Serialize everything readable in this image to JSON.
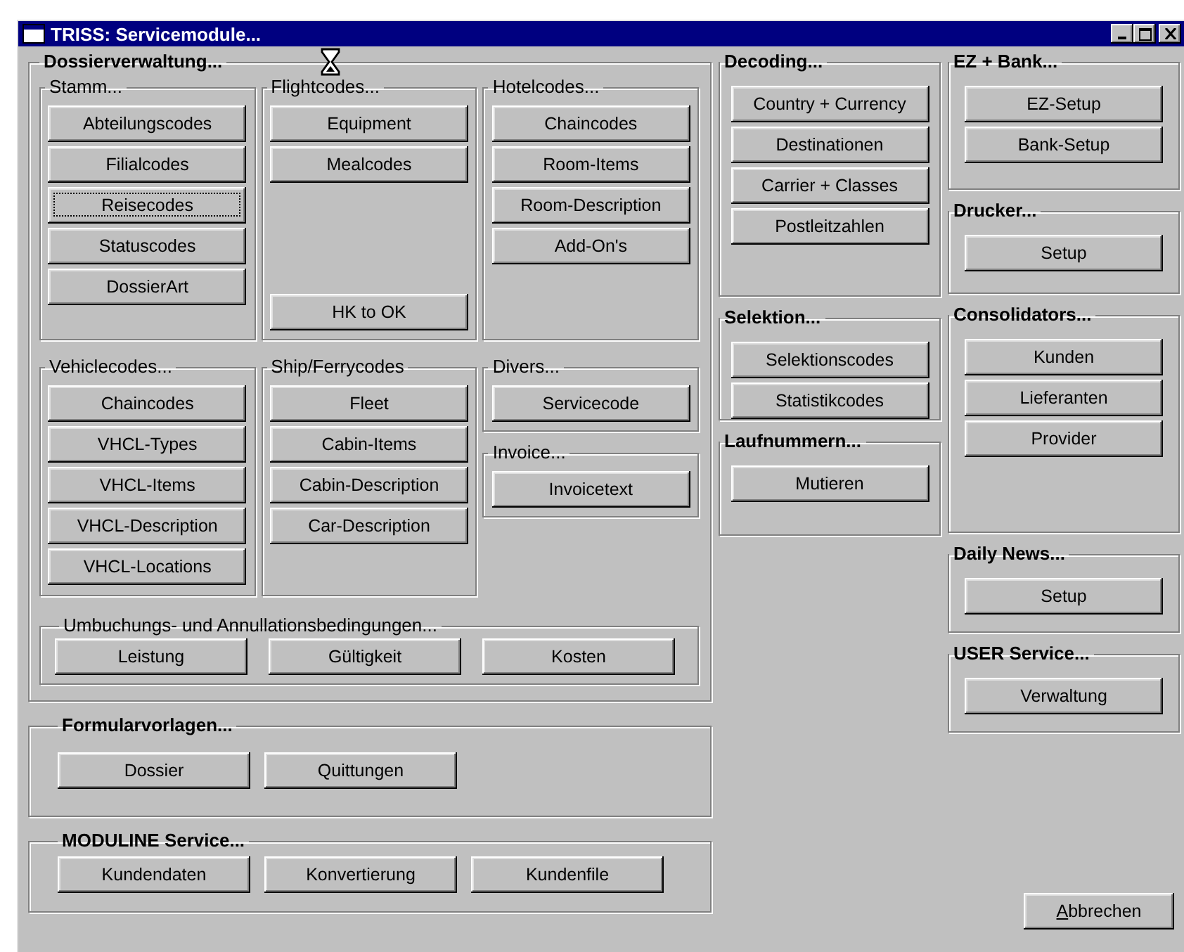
{
  "window": {
    "title": "TRISS: Servicemodule..."
  },
  "dossier": {
    "title": "Dossierverwaltung...",
    "rows": [
      [
        [
          {
            "title": "Stamm...",
            "buttons": [
              {
                "label": "Abteilungscodes",
                "focused": false
              },
              {
                "label": "Filialcodes",
                "focused": false
              },
              {
                "label": "Reisecodes",
                "focused": true
              },
              {
                "label": "Statuscodes",
                "focused": false
              },
              {
                "label": "DossierArt",
                "focused": false
              }
            ]
          }
        ],
        [
          {
            "title": "Flightcodes...",
            "buttons": [
              {
                "label": "Equipment",
                "focused": false
              },
              {
                "label": "Mealcodes",
                "focused": false
              },
              {
                "label": "HK to OK",
                "focused": false
              }
            ]
          }
        ],
        [
          {
            "title": "Hotelcodes...",
            "buttons": [
              {
                "label": "Chaincodes",
                "focused": false
              },
              {
                "label": "Room-Items",
                "focused": false
              },
              {
                "label": "Room-Description",
                "focused": false
              },
              {
                "label": "Add-On's",
                "focused": false
              }
            ]
          }
        ]
      ],
      [
        [
          {
            "title": "Vehiclecodes...",
            "buttons": [
              {
                "label": "Chaincodes",
                "focused": false
              },
              {
                "label": "VHCL-Types",
                "focused": false
              },
              {
                "label": "VHCL-Items",
                "focused": false
              },
              {
                "label": "VHCL-Description",
                "focused": false
              },
              {
                "label": "VHCL-Locations",
                "focused": false
              }
            ]
          }
        ],
        [
          {
            "title": "Ship/Ferrycodes",
            "buttons": [
              {
                "label": "Fleet",
                "focused": false
              },
              {
                "label": "Cabin-Items",
                "focused": false
              },
              {
                "label": "Cabin-Description",
                "focused": false
              },
              {
                "label": "Car-Description",
                "focused": false
              }
            ]
          }
        ],
        [
          {
            "title": "Divers...",
            "buttons": [
              {
                "label": "Servicecode",
                "focused": false
              }
            ]
          },
          {
            "title": "Invoice...",
            "buttons": [
              {
                "label": "Invoicetext",
                "focused": false
              }
            ]
          }
        ]
      ]
    ],
    "conditions": {
      "title": "Umbuchungs- und Annullationsbedingungen...",
      "buttons": [
        {
          "label": "Leistung",
          "focused": false
        },
        {
          "label": "Gültigkeit",
          "focused": false
        },
        {
          "label": "Kosten",
          "focused": false
        }
      ]
    }
  },
  "lower_groups": [
    {
      "title": "Formularvorlagen...",
      "buttons": [
        {
          "label": "Dossier",
          "focused": false
        },
        {
          "label": "Quittungen",
          "focused": false
        }
      ]
    },
    {
      "title": "MODULINE Service...",
      "buttons": [
        {
          "label": "Kundendaten",
          "focused": false
        },
        {
          "label": "Konvertierung",
          "focused": false
        },
        {
          "label": "Kundenfile",
          "focused": false
        }
      ]
    }
  ],
  "middle_column": [
    {
      "title": "Decoding...",
      "buttons": [
        {
          "label": "Country + Currency",
          "focused": false
        },
        {
          "label": "Destinationen",
          "focused": false
        },
        {
          "label": "Carrier + Classes",
          "focused": false
        },
        {
          "label": "Postleitzahlen",
          "focused": false
        }
      ]
    },
    {
      "title": "Selektion...",
      "buttons": [
        {
          "label": "Selektionscodes",
          "focused": false
        },
        {
          "label": "Statistikcodes",
          "focused": false
        }
      ]
    },
    {
      "title": "Laufnummern...",
      "buttons": [
        {
          "label": "Mutieren",
          "focused": false
        }
      ]
    }
  ],
  "right_column": [
    {
      "title": "EZ + Bank...",
      "buttons": [
        {
          "label": "EZ-Setup",
          "focused": false
        },
        {
          "label": "Bank-Setup",
          "focused": false
        }
      ]
    },
    {
      "title": "Drucker...",
      "buttons": [
        {
          "label": "Setup",
          "focused": false
        }
      ]
    },
    {
      "title": "Consolidators...",
      "buttons": [
        {
          "label": "Kunden",
          "focused": false
        },
        {
          "label": "Lieferanten",
          "focused": false
        },
        {
          "label": "Provider",
          "focused": false
        }
      ]
    },
    {
      "title": "Daily News...",
      "buttons": [
        {
          "label": "Setup",
          "focused": false
        }
      ]
    },
    {
      "title": "USER Service...",
      "buttons": [
        {
          "label": "Verwaltung",
          "focused": false
        }
      ]
    }
  ],
  "cancel_button": {
    "accelerator": "A",
    "rest": "bbrechen"
  }
}
